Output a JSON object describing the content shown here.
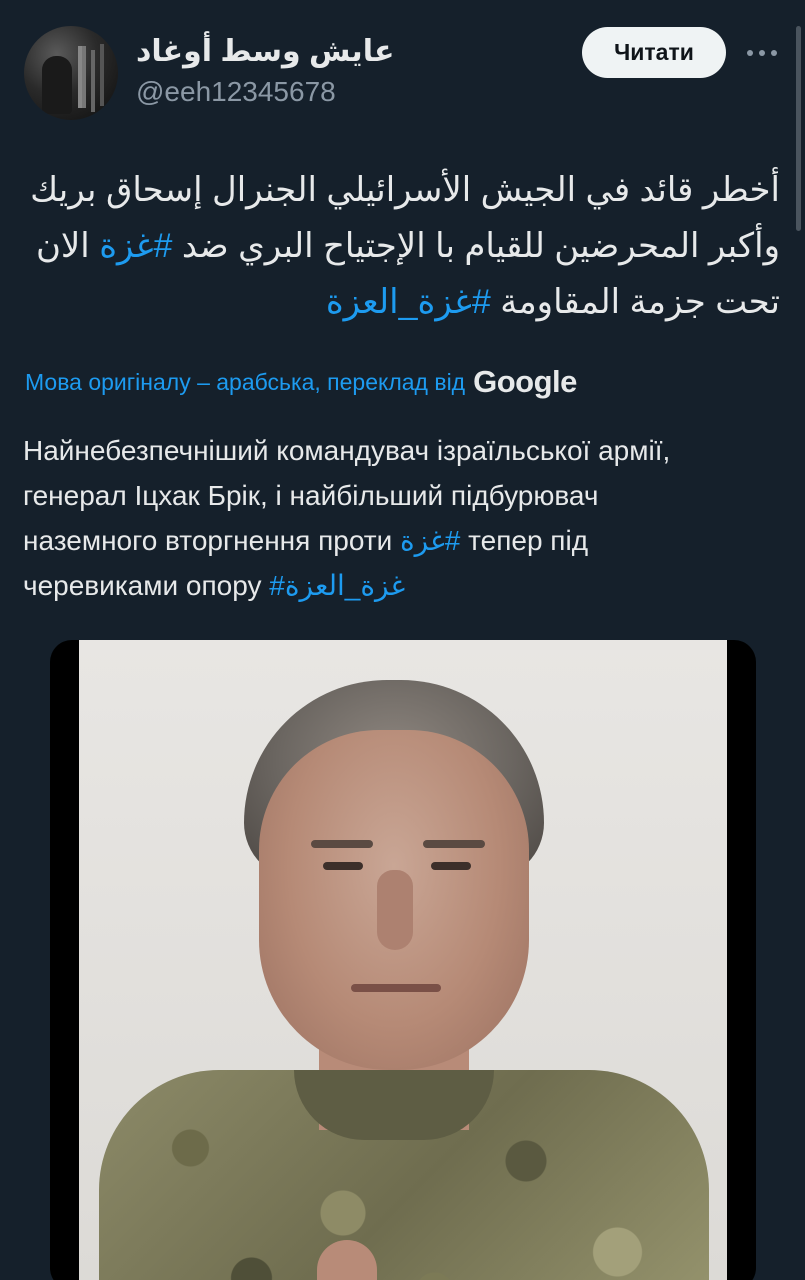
{
  "author": {
    "display_name": "عايش وسط أوغاد",
    "handle": "@eeh12345678"
  },
  "header": {
    "read_button_label": "Читати",
    "more_icon": "more-horizontal-icon"
  },
  "tweet": {
    "arabic_line1": "أخطر قائد في الجيش الأسرائيلي الجنرال إسحاق بريك",
    "arabic_line2_pre": "وأكبر المحرضين للقيام با الإجتياح البري ضد ",
    "arabic_line2_tag": "#غزة",
    "arabic_line2_post": " الان",
    "arabic_line3_pre": "تحت جزمة المقاومة  ",
    "arabic_line3_tag": "#غزة_العزة"
  },
  "translation": {
    "label": "Мова оригіналу – арабська, переклад від",
    "provider": "Google",
    "line1": "Найнебезпечніший командувач ізраїльської армії,",
    "line2": "генерал Іцхак Брік, і найбільший підбурювач",
    "line3_pre": "наземного вторгнення проти ",
    "line3_tag": "غزة#",
    "line3_post": " тепер під",
    "line4_pre": "черевиками опору ",
    "line4_tag": "#غزة_العزة"
  },
  "colors": {
    "background": "#15202b",
    "link": "#1d9bf0",
    "text": "#e7e9ea",
    "secondary": "#8b98a5"
  }
}
